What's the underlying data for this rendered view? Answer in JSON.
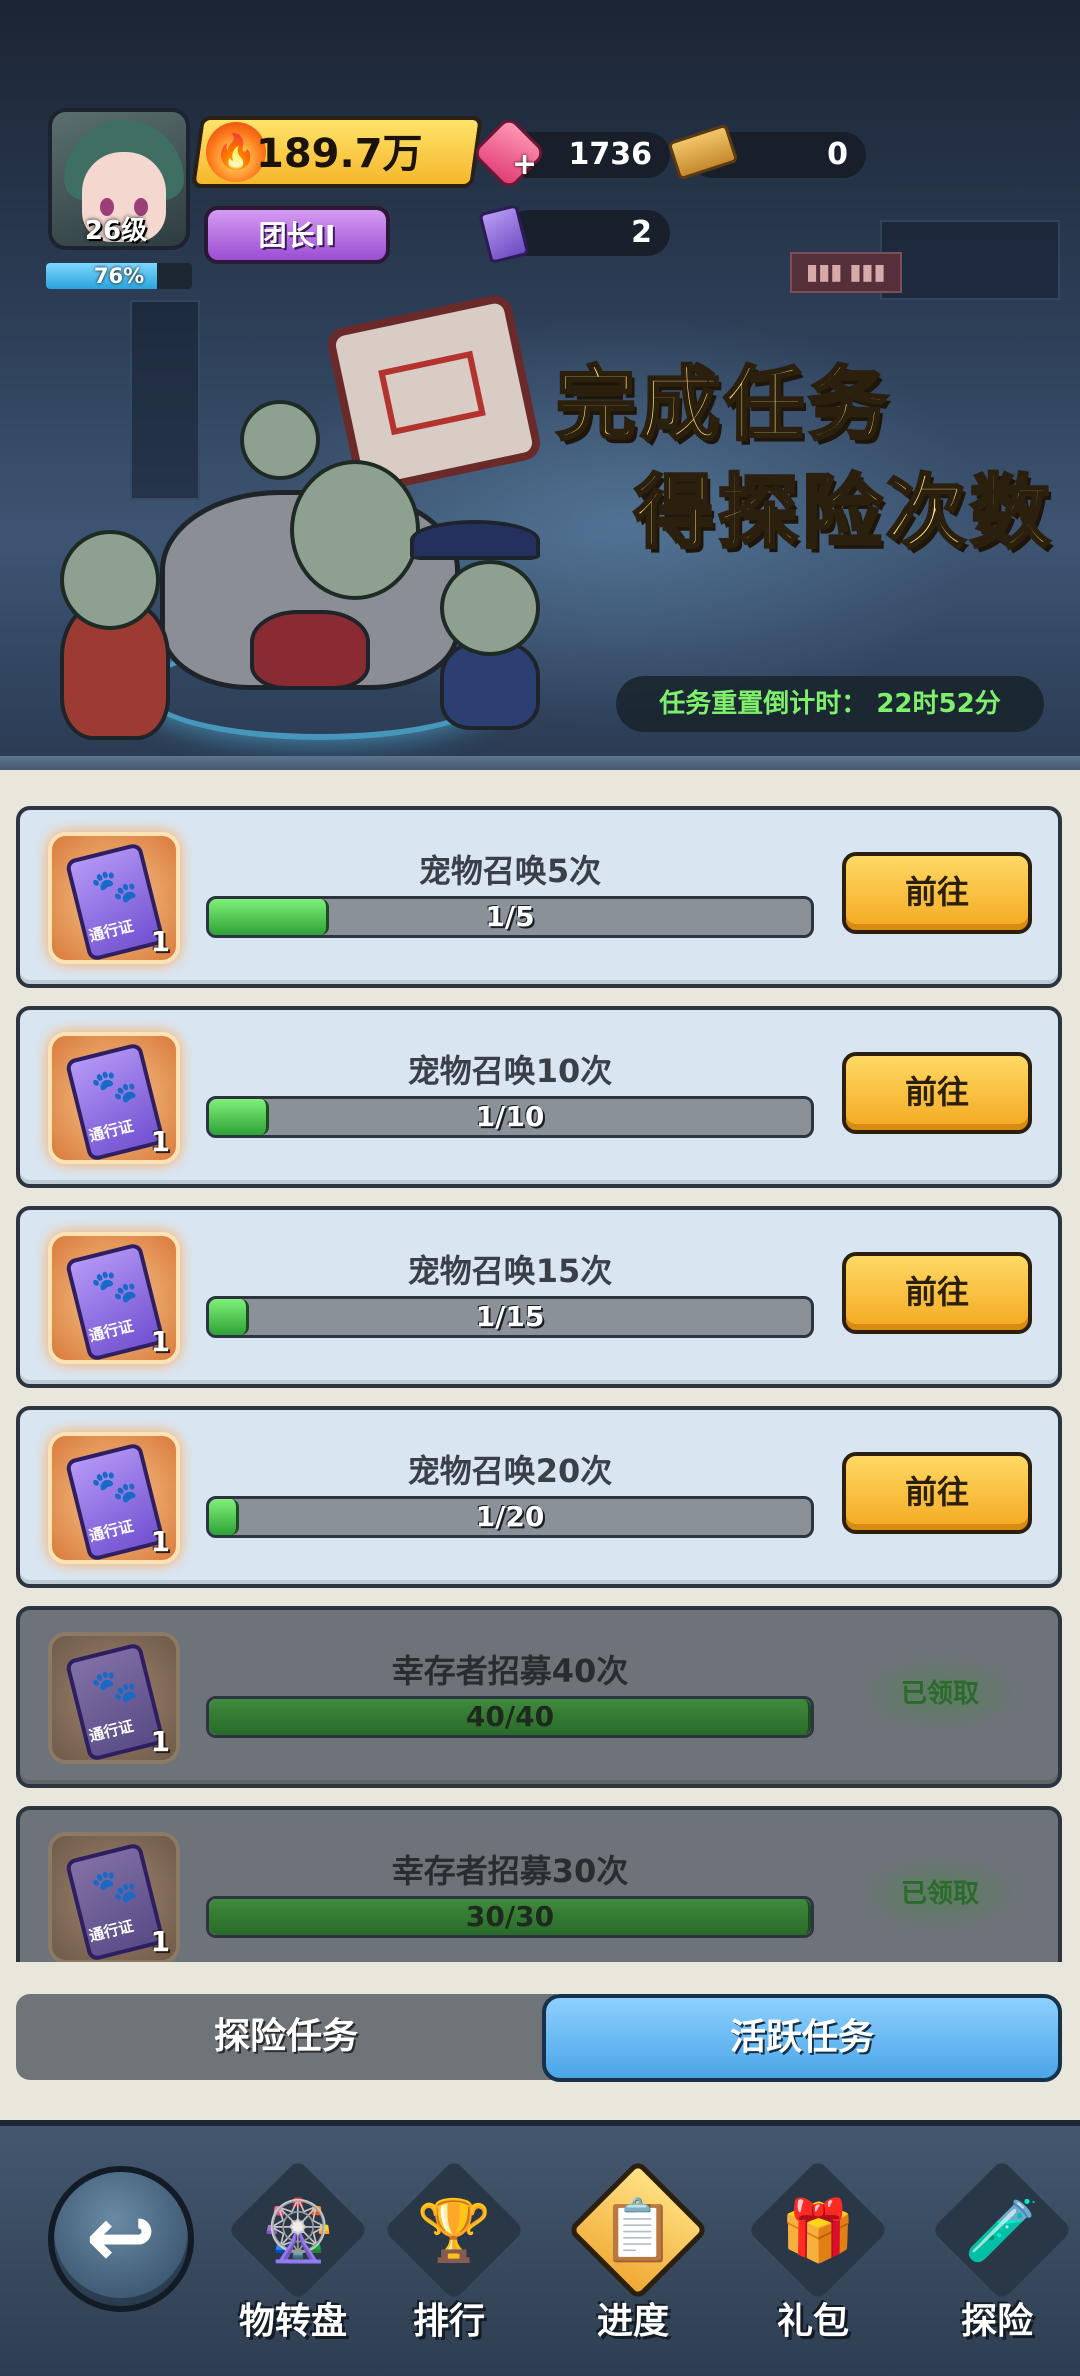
{
  "player": {
    "level": "26级",
    "xp_percent_label": "76%",
    "xp_percent": 0.76,
    "power": "189.7万",
    "rank": "团长II"
  },
  "currencies": {
    "gems": "1736",
    "tickets": "0",
    "pet_passes": "2"
  },
  "promo": {
    "line1": "完成任务",
    "line2": "得探险次数"
  },
  "countdown": "任务重置倒计时：  22时52分",
  "tasks": [
    {
      "title": "宠物召唤5次",
      "progress": "1/5",
      "fraction": 0.2,
      "reward_label": "通行证",
      "reward_count": "1",
      "button": "前往",
      "state": "active"
    },
    {
      "title": "宠物召唤10次",
      "progress": "1/10",
      "fraction": 0.1,
      "reward_label": "通行证",
      "reward_count": "1",
      "button": "前往",
      "state": "active"
    },
    {
      "title": "宠物召唤15次",
      "progress": "1/15",
      "fraction": 0.0667,
      "reward_label": "通行证",
      "reward_count": "1",
      "button": "前往",
      "state": "active"
    },
    {
      "title": "宠物召唤20次",
      "progress": "1/20",
      "fraction": 0.05,
      "reward_label": "通行证",
      "reward_count": "1",
      "button": "前往",
      "state": "active"
    },
    {
      "title": "幸存者招募40次",
      "progress": "40/40",
      "fraction": 1.0,
      "reward_label": "通行证",
      "reward_count": "1",
      "button": "已领取",
      "state": "done"
    },
    {
      "title": "幸存者招募30次",
      "progress": "30/30",
      "fraction": 1.0,
      "reward_label": "通行证",
      "reward_count": "1",
      "button": "已领取",
      "state": "done"
    }
  ],
  "tabs": {
    "explore": "探险任务",
    "active": "活跃任务"
  },
  "nav": {
    "items": [
      {
        "label": "物转盘",
        "icon": "🎡"
      },
      {
        "label": "排行",
        "icon": "🏆"
      },
      {
        "label": "进度",
        "icon": "📋"
      },
      {
        "label": "礼包",
        "icon": "🎁"
      },
      {
        "label": "探险",
        "icon": "🧪"
      }
    ]
  },
  "icons": {
    "back": "↩",
    "flame": "🔥",
    "paw": "🐾"
  },
  "colors": {
    "accent_gold": "#f4a821",
    "progress_green": "#2da235",
    "tab_active": "#4aa5e6",
    "countdown_green": "#7ef06b"
  }
}
